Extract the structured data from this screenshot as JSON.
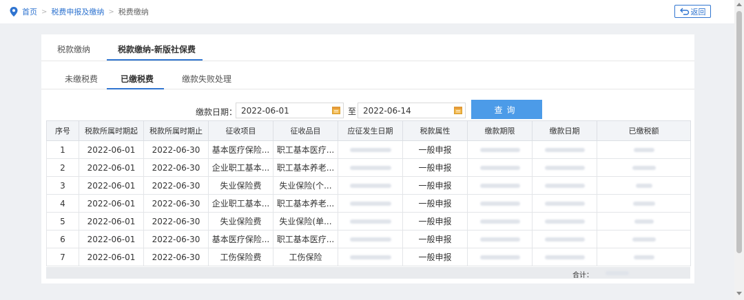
{
  "breadcrumb": {
    "home": "首页",
    "level2": "税费申报及缴纳",
    "current": "税费缴纳",
    "sep": ">"
  },
  "header": {
    "back_label": "返回"
  },
  "tabs_primary": [
    {
      "label": "税款缴纳"
    },
    {
      "label": "税款缴纳-新版社保费"
    }
  ],
  "tabs_secondary": [
    {
      "label": "未缴税费"
    },
    {
      "label": "已缴税费"
    },
    {
      "label": "缴款失败处理"
    }
  ],
  "filter": {
    "label": "缴款日期：",
    "start_date": "2022-06-01",
    "to_label": "至",
    "end_date": "2022-06-14",
    "query_label": "查询"
  },
  "table": {
    "columns": [
      "序号",
      "税款所属时期起",
      "税款所属时期止",
      "征收项目",
      "征收品目",
      "应征发生日期",
      "税款属性",
      "缴款期限",
      "缴款日期",
      "已缴税额"
    ],
    "rows": [
      {
        "no": "1",
        "start": "2022-06-01",
        "end": "2022-06-30",
        "item": "基本医疗保险...",
        "subitem": "职工基本医疗...",
        "attr": "一般申报"
      },
      {
        "no": "2",
        "start": "2022-06-01",
        "end": "2022-06-30",
        "item": "企业职工基本...",
        "subitem": "职工基本养老...",
        "attr": "一般申报"
      },
      {
        "no": "3",
        "start": "2022-06-01",
        "end": "2022-06-30",
        "item": "失业保险费",
        "subitem": "失业保险(个...",
        "attr": "一般申报"
      },
      {
        "no": "4",
        "start": "2022-06-01",
        "end": "2022-06-30",
        "item": "企业职工基本...",
        "subitem": "职工基本养老...",
        "attr": "一般申报"
      },
      {
        "no": "5",
        "start": "2022-06-01",
        "end": "2022-06-30",
        "item": "失业保险费",
        "subitem": "失业保险(单...",
        "attr": "一般申报"
      },
      {
        "no": "6",
        "start": "2022-06-01",
        "end": "2022-06-30",
        "item": "基本医疗保险...",
        "subitem": "职工基本医疗...",
        "attr": "一般申报"
      },
      {
        "no": "7",
        "start": "2022-06-01",
        "end": "2022-06-30",
        "item": "工伤保险费",
        "subitem": "工伤保险",
        "attr": "一般申报"
      }
    ],
    "total_label": "合计："
  },
  "colors": {
    "accent": "#2f74d0",
    "query_button": "#4c9be8",
    "header_bg": "#f2f4f7",
    "page_bg": "#eef0f3"
  },
  "icons": {
    "location": "map-pin-icon",
    "back": "return-arrow-icon",
    "calendar": "calendar-icon"
  }
}
